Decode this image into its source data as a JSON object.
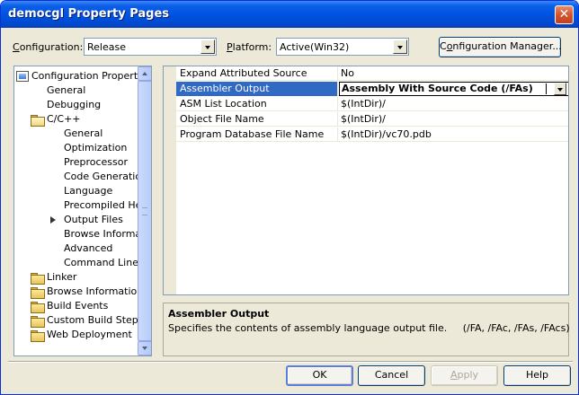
{
  "window": {
    "title": "democgl Property Pages",
    "close_glyph": "✕"
  },
  "toolbar": {
    "configuration_label": "onfiguration:",
    "configuration_mnemonic": "C",
    "configuration_value": "Release",
    "platform_label": "latform:",
    "platform_mnemonic": "P",
    "platform_value": "Active(Win32)",
    "config_manager_prefix": "C",
    "config_manager_mnemonic": "o",
    "config_manager_rest": "nfiguration Manager..."
  },
  "tree": {
    "items": [
      {
        "label": "Configuration Properties",
        "icon": "config-properties-icon"
      },
      {
        "label": "General"
      },
      {
        "label": "Debugging"
      },
      {
        "label": "C/C++",
        "icon": "folder-open-icon"
      },
      {
        "label": "General"
      },
      {
        "label": "Optimization"
      },
      {
        "label": "Preprocessor"
      },
      {
        "label": "Code Generation"
      },
      {
        "label": "Language"
      },
      {
        "label": "Precompiled Hea"
      },
      {
        "label": "Output Files",
        "icon": "current-page-arrow-icon"
      },
      {
        "label": "Browse Informat"
      },
      {
        "label": "Advanced"
      },
      {
        "label": "Command Line"
      },
      {
        "label": "Linker",
        "icon": "folder-icon"
      },
      {
        "label": "Browse Information",
        "icon": "folder-icon"
      },
      {
        "label": "Build Events",
        "icon": "folder-icon"
      },
      {
        "label": "Custom Build Step",
        "icon": "folder-icon"
      },
      {
        "label": "Web Deployment",
        "icon": "folder-icon"
      }
    ]
  },
  "properties": {
    "rows": [
      {
        "name": "Expand Attributed Source",
        "value": "No"
      },
      {
        "name": "Assembler Output",
        "value": "Assembly With Source Code (/FAs)"
      },
      {
        "name": "ASM List Location",
        "value": "$(IntDir)/"
      },
      {
        "name": "Object File Name",
        "value": "$(IntDir)/"
      },
      {
        "name": "Program Database File Name",
        "value": "$(IntDir)/vc70.pdb"
      }
    ]
  },
  "description": {
    "title": "Assembler Output",
    "text": "Specifies the contents of assembly language output file.     (/FA, /FAc, /FAs, /FAcs)"
  },
  "buttons": {
    "ok": "OK",
    "cancel": "Cancel",
    "apply_mnemonic": "A",
    "apply_rest": "pply",
    "help": "Help"
  }
}
